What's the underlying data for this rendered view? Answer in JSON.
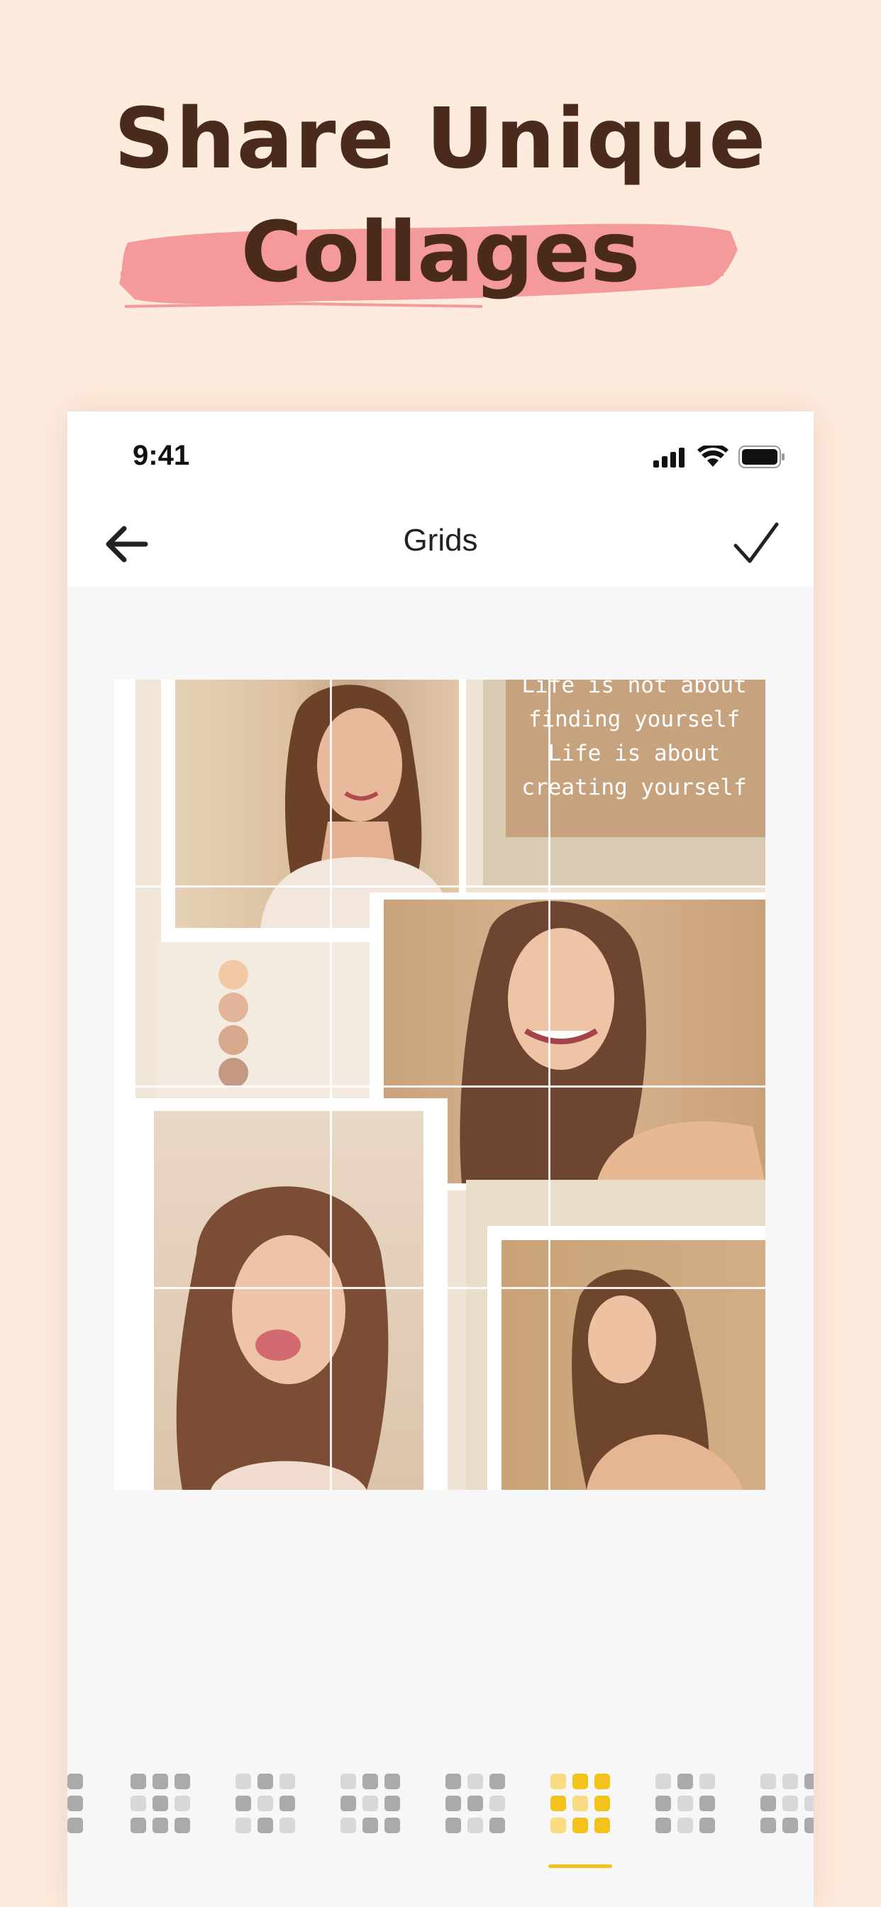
{
  "headline": {
    "line1": "Share Unique",
    "line2": "Collages",
    "brush_color": "#f59a9a",
    "text_color": "#4a2a1a"
  },
  "statusbar": {
    "time": "9:41",
    "icons": [
      "cellular-signal-icon",
      "wifi-icon",
      "battery-icon"
    ]
  },
  "navbar": {
    "title": "Grids",
    "back_icon": "arrow-left-icon",
    "done_icon": "checkmark-icon"
  },
  "collage": {
    "quote": "Life is not about\nfinding yourself\nLife is about\ncreating yourself"
  },
  "toolbar": {
    "layouts": [
      {
        "name": "grid-layout-partial"
      },
      {
        "name": "grid-layout-1"
      },
      {
        "name": "grid-layout-2"
      },
      {
        "name": "grid-layout-3"
      },
      {
        "name": "grid-layout-4"
      },
      {
        "name": "grid-layout-5",
        "selected": true
      },
      {
        "name": "grid-layout-6"
      },
      {
        "name": "grid-layout-7"
      }
    ],
    "accent_color": "#f4c21c"
  }
}
